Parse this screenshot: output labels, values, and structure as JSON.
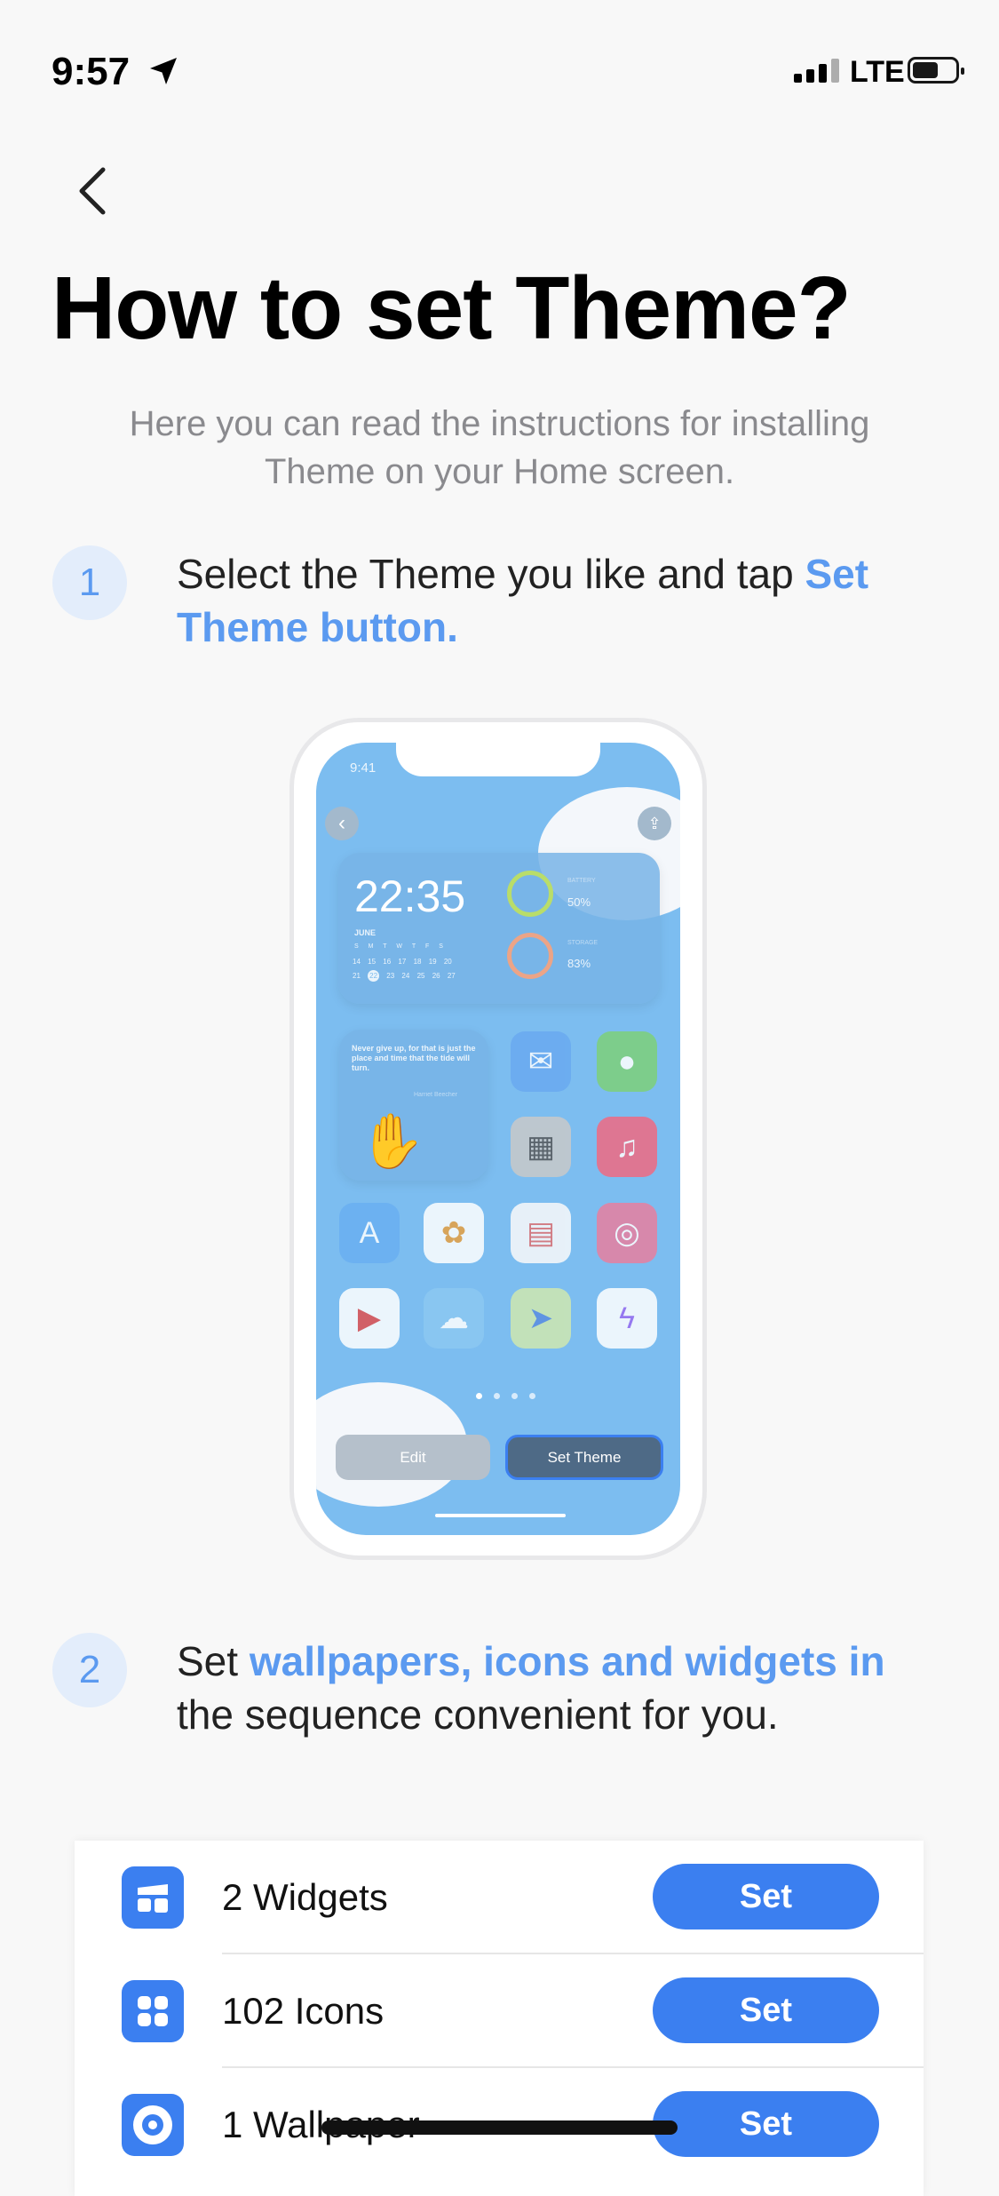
{
  "status_bar": {
    "time": "9:57",
    "network": "LTE",
    "icons": [
      "location-arrow-icon",
      "signal-icon",
      "battery-icon"
    ]
  },
  "header": {
    "back_icon": "chevron-left-icon",
    "title": "How to set Theme?",
    "subtitle": "Here you can read the instructions for installing Theme on your Home screen."
  },
  "steps": [
    {
      "number": "1",
      "text": "Select the Theme you like and tap ",
      "highlight": "Set Theme button."
    },
    {
      "number": "2",
      "text_before": "Set ",
      "highlight": "wallpapers, icons and widgets in",
      "text_after": " the sequence convenient for you."
    }
  ],
  "preview": {
    "time": "9:41",
    "clock": "22:35",
    "month": "JUNE",
    "weekdays": [
      "S",
      "M",
      "T",
      "W",
      "T",
      "F",
      "S"
    ],
    "week1": [
      "14",
      "15",
      "16",
      "17",
      "18",
      "19",
      "20"
    ],
    "week2": [
      "21",
      "22",
      "23",
      "24",
      "25",
      "26",
      "27"
    ],
    "selected_day": "22",
    "battery_label": "BATTERY",
    "battery_value": "50%",
    "storage_label": "STORAGE",
    "storage_value": "83%",
    "quote": "Never give up, for that is just the place and time that the tide will turn.",
    "quote_author": "Harriet Beecher",
    "apps": [
      "mail",
      "messages",
      "calculator",
      "music",
      "app-store",
      "photos",
      "calendar",
      "instagram",
      "youtube",
      "weather",
      "maps",
      "messenger"
    ],
    "edit_label": "Edit",
    "set_theme_label": "Set Theme"
  },
  "items": [
    {
      "icon": "widgets-icon",
      "label": "2 Widgets",
      "button": "Set"
    },
    {
      "icon": "icons-grid-icon",
      "label": "102 Icons",
      "button": "Set"
    },
    {
      "icon": "wallpaper-icon",
      "label": "1 Wallpaper",
      "button": "Set"
    }
  ],
  "colors": {
    "accent": "#3b7ff0",
    "highlight": "#5b9af0",
    "preview_bg": "#7cbdf0"
  }
}
